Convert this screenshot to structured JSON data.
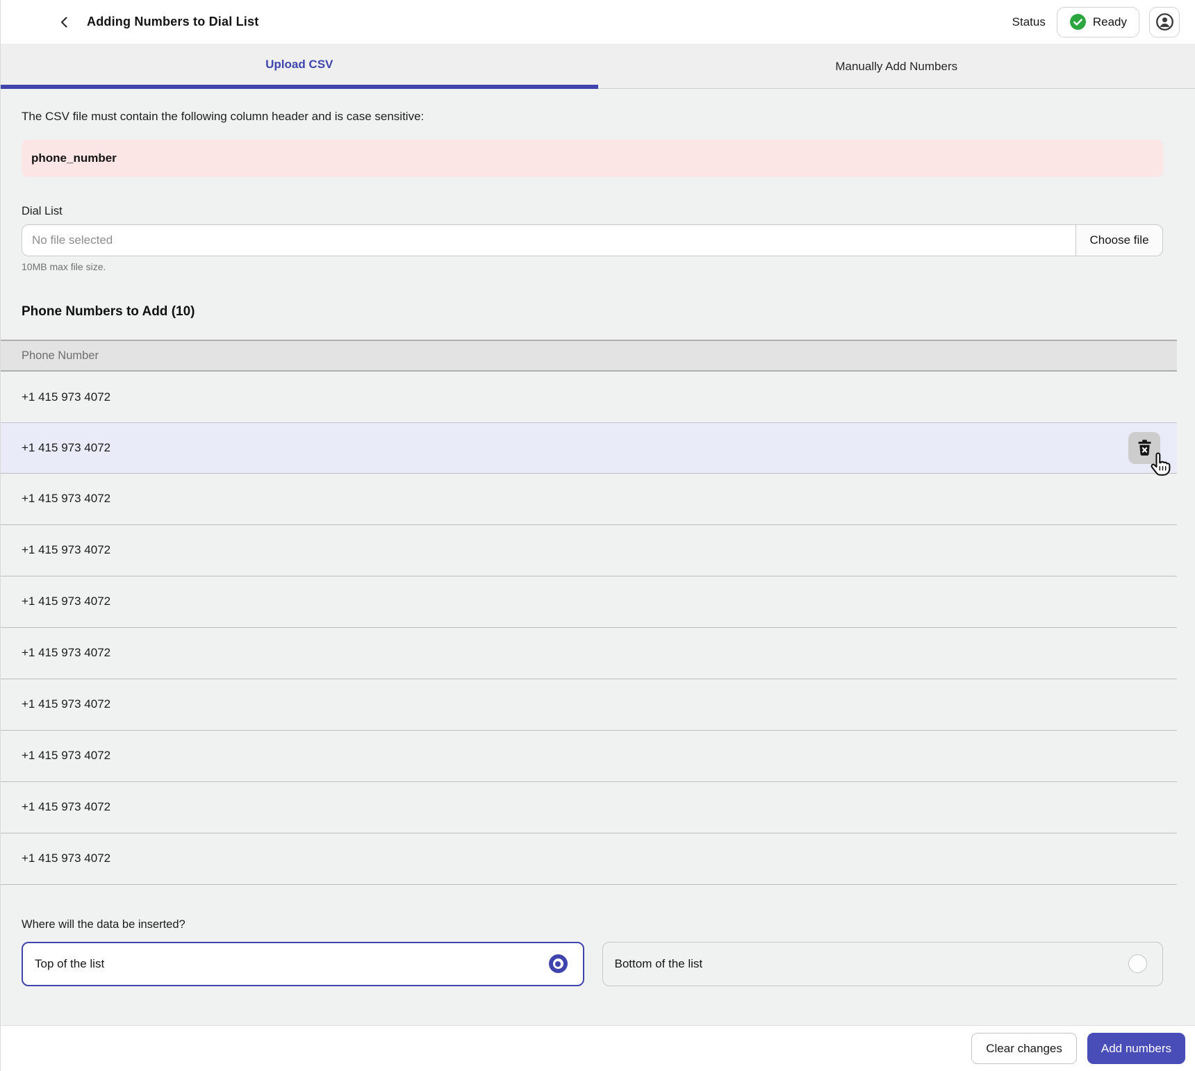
{
  "header": {
    "title": "Adding Numbers to Dial List",
    "status_label": "Status",
    "status_value": "Ready"
  },
  "tabs": [
    {
      "label": "Upload CSV",
      "active": true
    },
    {
      "label": "Manually Add Numbers",
      "active": false
    }
  ],
  "upload": {
    "instruction": "The CSV file must contain the following column header and is case sensitive:",
    "required_header": "phone_number",
    "file_field_label": "Dial List",
    "file_placeholder": "No file selected",
    "choose_file_label": "Choose file",
    "file_hint": "10MB max file size."
  },
  "phone_list": {
    "heading": "Phone Numbers to Add (10)",
    "count": 10,
    "column_header": "Phone Number",
    "highlighted_row_index": 1,
    "rows": [
      "+1 415 973 4072",
      "+1 415 973 4072",
      "+1 415 973 4072",
      "+1 415 973 4072",
      "+1 415 973 4072",
      "+1 415 973 4072",
      "+1 415 973 4072",
      "+1 415 973 4072",
      "+1 415 973 4072",
      "+1 415 973 4072"
    ]
  },
  "insert_position": {
    "question": "Where will the data be inserted?",
    "options": [
      {
        "label": "Top of the list",
        "selected": true
      },
      {
        "label": "Bottom of the list",
        "selected": false
      }
    ]
  },
  "footer": {
    "clear_label": "Clear changes",
    "add_label": "Add numbers"
  },
  "colors": {
    "accent": "#3f45ad",
    "accent_button": "#484db8",
    "ready_green": "#2ba63e",
    "pink_bg": "#fbe5e5",
    "row_highlight": "#e9ebf8",
    "page_bg": "#f0f1f1",
    "header_bg": "#ffffff",
    "table_header_bg": "#e3e3e3"
  }
}
